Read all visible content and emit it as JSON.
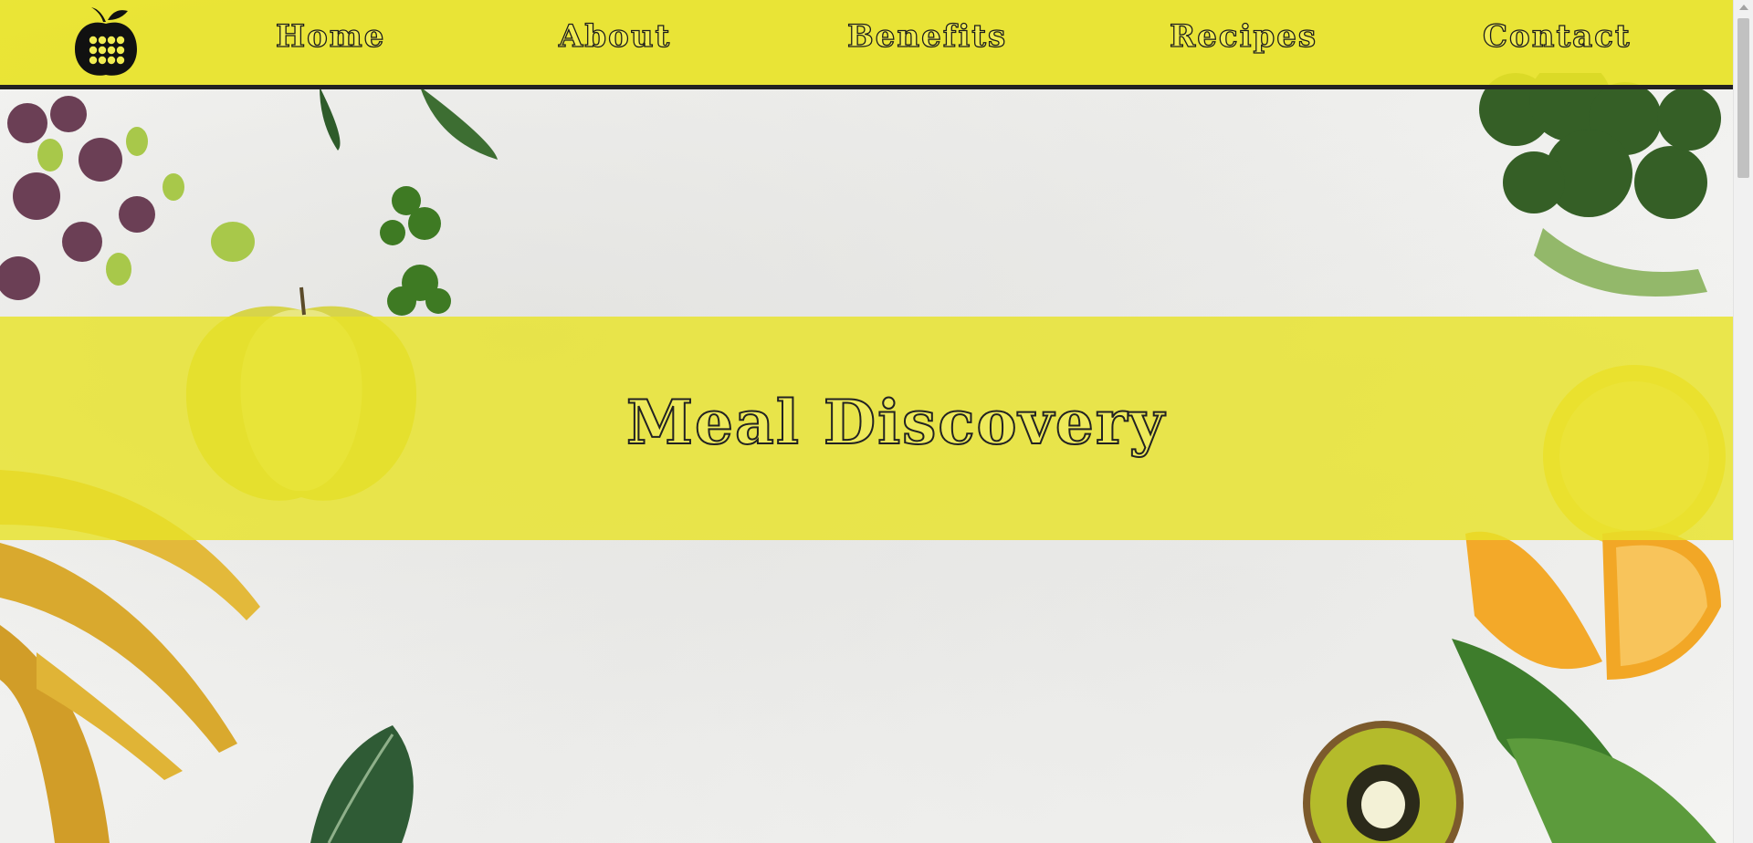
{
  "nav": {
    "logo_icon": "apple-calculator-logo-icon",
    "links": [
      "Home",
      "About",
      "Benefits",
      "Recipes",
      "Contact"
    ]
  },
  "hero": {
    "title": "Meal Discovery"
  },
  "colors": {
    "brand_yellow": "#e8e328",
    "outline": "#1c1c1c"
  },
  "background_decor": [
    "microgreens",
    "spinach-leaves",
    "parsley",
    "apple-half",
    "broccoli",
    "lemon",
    "orange-slices",
    "kiwi-half",
    "bananas",
    "kale-leaf"
  ]
}
